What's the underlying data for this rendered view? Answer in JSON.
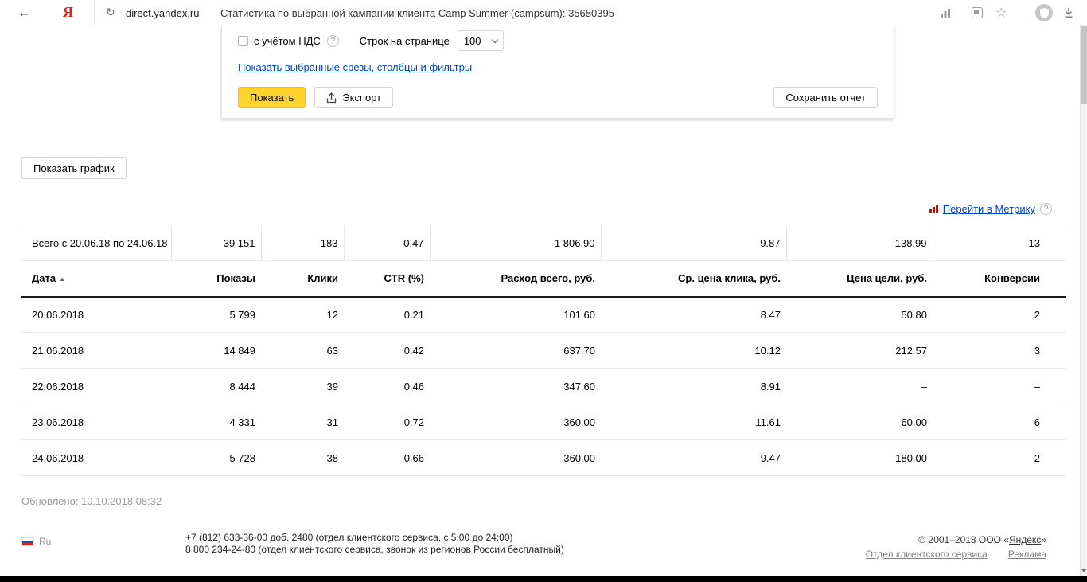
{
  "icons": {
    "help": "?",
    "sort_asc": "▲"
  },
  "browser": {
    "url": "direct.yandex.ru",
    "page_title": "Статистика по выбранной кампании клиента Camp Summer (campsum): 35680395",
    "logo": "Я",
    "back_glyph": "←",
    "refresh_glyph": "↻",
    "star_glyph": "☆"
  },
  "panel": {
    "vat_label": "с учётом НДС",
    "rows_label": "Строк на странице",
    "rows_value": "100",
    "slices_link": "Показать выбранные срезы, столбцы и фильтры",
    "show_button": "Показать",
    "export_button": "Экспорт",
    "save_button": "Сохранить отчет"
  },
  "content": {
    "show_chart_button": "Показать график",
    "metrika_link": "Перейти в Метрику",
    "updated": "Обновлено: 10.10.2018 08:32"
  },
  "table": {
    "total": [
      "Всего с 20.06.18 по 24.06.18",
      "39 151",
      "183",
      "0.47",
      "1 806.90",
      "9.87",
      "138.99",
      "13"
    ],
    "headers": [
      "Дата",
      "Показы",
      "Клики",
      "CTR (%)",
      "Расход всего, руб.",
      "Ср. цена клика, руб.",
      "Цена цели, руб.",
      "Конверсии"
    ],
    "rows": [
      [
        "20.06.2018",
        "5 799",
        "12",
        "0.21",
        "101.60",
        "8.47",
        "50.80",
        "2"
      ],
      [
        "21.06.2018",
        "14 849",
        "63",
        "0.42",
        "637.70",
        "10.12",
        "212.57",
        "3"
      ],
      [
        "22.06.2018",
        "8 444",
        "39",
        "0.46",
        "347.60",
        "8.91",
        "–",
        "–"
      ],
      [
        "23.06.2018",
        "4 331",
        "31",
        "0.72",
        "360.00",
        "11.61",
        "60.00",
        "6"
      ],
      [
        "24.06.2018",
        "5 728",
        "38",
        "0.66",
        "360.00",
        "9.47",
        "180.00",
        "2"
      ]
    ]
  },
  "footer": {
    "lang": "Ru",
    "phone_line1": "+7 (812) 633-36-00 доб. 2480 (отдел клиентского сервиса, с 5:00 до 24:00)",
    "phone_line2": "8 800 234-24-80 (отдел клиентского сервиса, звонок из регионов России бесплатный)",
    "copyright_prefix": "© 2001–2018  ООО «",
    "company_link": "Яндекс",
    "copyright_suffix": "»",
    "links": [
      "Отдел клиентского сервиса",
      "Реклама"
    ]
  }
}
